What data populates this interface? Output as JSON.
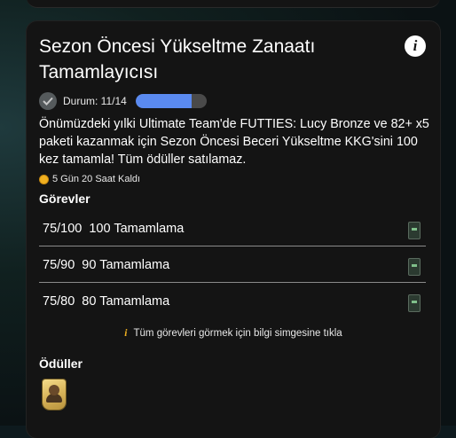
{
  "card": {
    "title": "Sezon Öncesi Yükseltme Zanaatı Tamamlayıcısı",
    "info_icon": "i",
    "status": {
      "label": "Durum: 11/14",
      "progress_fraction": 0.79,
      "check_icon": "check-icon"
    },
    "description": "Önümüzdeki yılki Ultimate Team'de FUTTIES: Lucy Bronze ve 82+ x5 paketi kazanmak için Sezon Öncesi Beceri Yükseltme KKG'sini 100 kez tamamla! Tüm ödüller satılamaz.",
    "time_left": "5 Gün 20 Saat Kaldı",
    "objectives_title": "Görevler",
    "objectives": [
      {
        "progress": "75/100",
        "label": "100 Tamamlama",
        "reward_icon": "pack-icon"
      },
      {
        "progress": "75/90",
        "label": "90 Tamamlama",
        "reward_icon": "pack-icon"
      },
      {
        "progress": "75/80",
        "label": "80 Tamamlama",
        "reward_icon": "pack-icon"
      }
    ],
    "hint": "Tüm görevleri görmek için bilgi simgesine tıkla",
    "hint_icon": "i",
    "rewards_title": "Ödüller",
    "rewards": [
      {
        "icon": "player-card-icon"
      }
    ]
  },
  "colors": {
    "card_bg": "#141414",
    "progress_fill": "#5a8af0",
    "accent_gold": "#f0b020"
  }
}
